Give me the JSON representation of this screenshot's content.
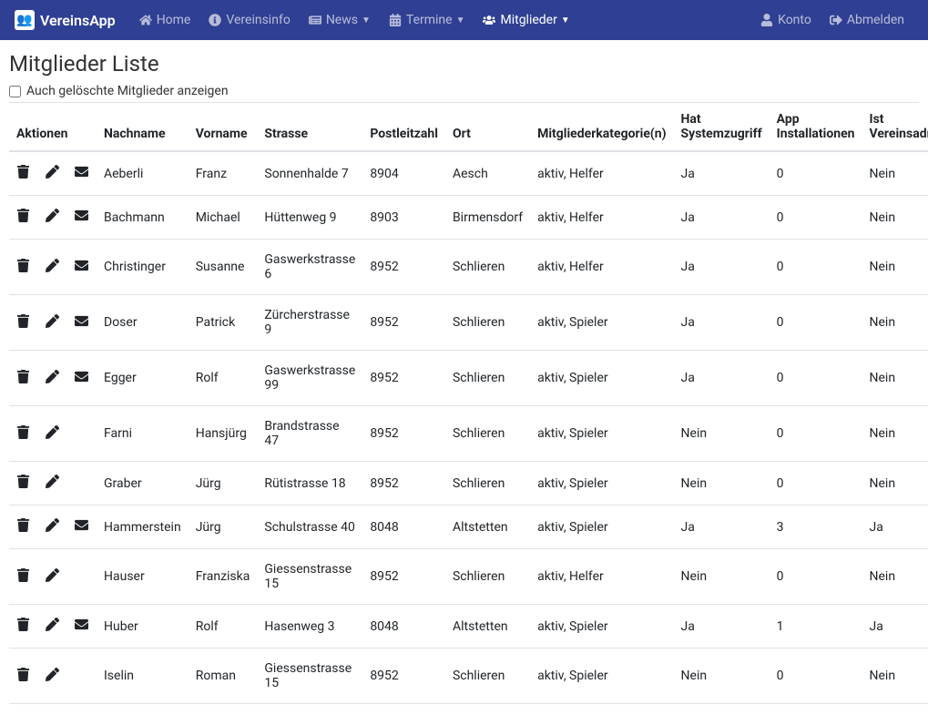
{
  "brand": "VereinsApp",
  "nav": {
    "home": "Home",
    "vereinsinfo": "Vereinsinfo",
    "news": "News",
    "termine": "Termine",
    "mitglieder": "Mitglieder",
    "konto": "Konto",
    "abmelden": "Abmelden"
  },
  "page": {
    "title": "Mitglieder Liste",
    "show_deleted": "Auch gelöschte Mitglieder anzeigen"
  },
  "columns": {
    "aktionen": "Aktionen",
    "nachname": "Nachname",
    "vorname": "Vorname",
    "strasse": "Strasse",
    "postleitzahl": "Postleitzahl",
    "ort": "Ort",
    "kategorien": "Mitgliederkategorie(n)",
    "systemzugriff": "Hat Systemzugriff",
    "installationen": "App Installationen",
    "admin": "Ist Vereinsadministrator"
  },
  "rows": [
    {
      "nachname": "Aeberli",
      "vorname": "Franz",
      "strasse": "Sonnenhalde 7",
      "plz": "8904",
      "ort": "Aesch",
      "kat": "aktiv, Helfer",
      "zugriff": "Ja",
      "inst": "0",
      "admin": "Nein",
      "email": true
    },
    {
      "nachname": "Bachmann",
      "vorname": "Michael",
      "strasse": "Hüttenweg 9",
      "plz": "8903",
      "ort": "Birmensdorf",
      "kat": "aktiv, Helfer",
      "zugriff": "Ja",
      "inst": "0",
      "admin": "Nein",
      "email": true
    },
    {
      "nachname": "Christinger",
      "vorname": "Susanne",
      "strasse": "Gaswerkstrasse 6",
      "plz": "8952",
      "ort": "Schlieren",
      "kat": "aktiv, Helfer",
      "zugriff": "Ja",
      "inst": "0",
      "admin": "Nein",
      "email": true
    },
    {
      "nachname": "Doser",
      "vorname": "Patrick",
      "strasse": "Zürcherstrasse 9",
      "plz": "8952",
      "ort": "Schlieren",
      "kat": "aktiv, Spieler",
      "zugriff": "Ja",
      "inst": "0",
      "admin": "Nein",
      "email": true
    },
    {
      "nachname": "Egger",
      "vorname": "Rolf",
      "strasse": "Gaswerkstrasse 99",
      "plz": "8952",
      "ort": "Schlieren",
      "kat": "aktiv, Spieler",
      "zugriff": "Ja",
      "inst": "0",
      "admin": "Nein",
      "email": true
    },
    {
      "nachname": "Farni",
      "vorname": "Hansjürg",
      "strasse": "Brandstrasse 47",
      "plz": "8952",
      "ort": "Schlieren",
      "kat": "aktiv, Spieler",
      "zugriff": "Nein",
      "inst": "0",
      "admin": "Nein",
      "email": false
    },
    {
      "nachname": "Graber",
      "vorname": "Jürg",
      "strasse": "Rütistrasse 18",
      "plz": "8952",
      "ort": "Schlieren",
      "kat": "aktiv, Spieler",
      "zugriff": "Nein",
      "inst": "0",
      "admin": "Nein",
      "email": false
    },
    {
      "nachname": "Hammerstein",
      "vorname": "Jürg",
      "strasse": "Schulstrasse 40",
      "plz": "8048",
      "ort": "Altstetten",
      "kat": "aktiv, Spieler",
      "zugriff": "Ja",
      "inst": "3",
      "admin": "Ja",
      "email": true
    },
    {
      "nachname": "Hauser",
      "vorname": "Franziska",
      "strasse": "Giessenstrasse 15",
      "plz": "8952",
      "ort": "Schlieren",
      "kat": "aktiv, Helfer",
      "zugriff": "Nein",
      "inst": "0",
      "admin": "Nein",
      "email": false
    },
    {
      "nachname": "Huber",
      "vorname": "Rolf",
      "strasse": "Hasenweg 3",
      "plz": "8048",
      "ort": "Altstetten",
      "kat": "aktiv, Spieler",
      "zugriff": "Ja",
      "inst": "1",
      "admin": "Ja",
      "email": true
    },
    {
      "nachname": "Iselin",
      "vorname": "Roman",
      "strasse": "Giessenstrasse 15",
      "plz": "8952",
      "ort": "Schlieren",
      "kat": "aktiv, Spieler",
      "zugriff": "Nein",
      "inst": "0",
      "admin": "Nein",
      "email": false
    }
  ]
}
